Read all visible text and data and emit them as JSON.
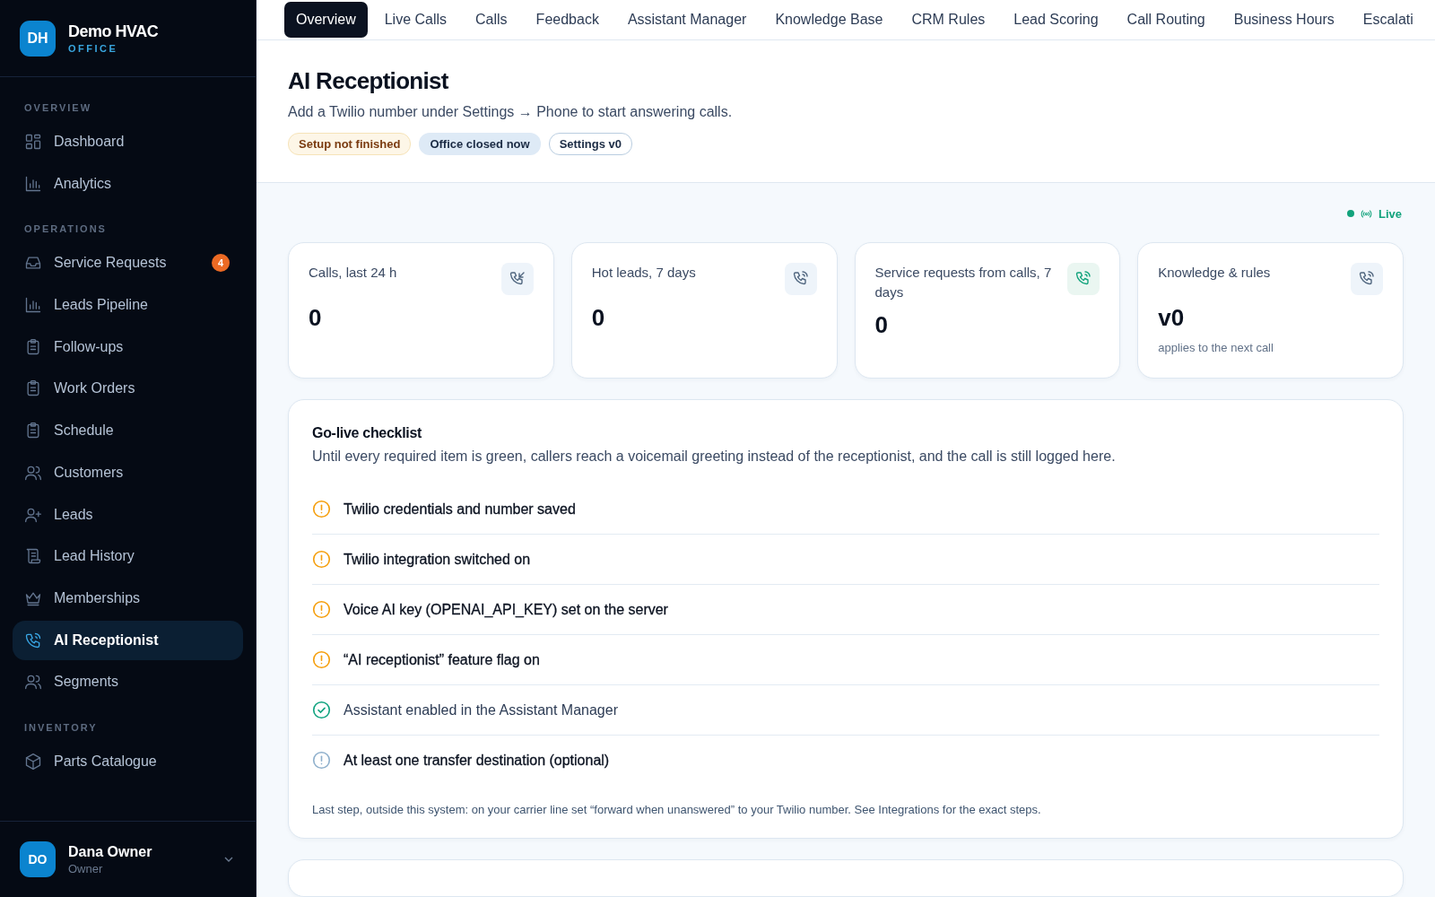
{
  "brand": {
    "initials": "DH",
    "name": "Demo HVAC",
    "subtitle": "OFFICE"
  },
  "sidebar": {
    "sections": [
      {
        "title": "OVERVIEW",
        "items": [
          {
            "label": "Dashboard",
            "selected": false
          },
          {
            "label": "Analytics",
            "selected": false
          }
        ]
      },
      {
        "title": "OPERATIONS",
        "items": [
          {
            "label": "Service Requests",
            "selected": false,
            "badge": "4"
          },
          {
            "label": "Leads Pipeline",
            "selected": false
          },
          {
            "label": "Follow-ups",
            "selected": false
          },
          {
            "label": "Work Orders",
            "selected": false
          },
          {
            "label": "Schedule",
            "selected": false
          },
          {
            "label": "Customers",
            "selected": false
          },
          {
            "label": "Leads",
            "selected": false
          },
          {
            "label": "Lead History",
            "selected": false
          },
          {
            "label": "Memberships",
            "selected": false
          },
          {
            "label": "AI Receptionist",
            "selected": true
          },
          {
            "label": "Segments",
            "selected": false
          }
        ]
      },
      {
        "title": "INVENTORY",
        "items": [
          {
            "label": "Parts Catalogue",
            "selected": false
          }
        ]
      }
    ]
  },
  "user": {
    "initials": "DO",
    "name": "Dana Owner",
    "role": "Owner"
  },
  "tabs": [
    {
      "label": "Overview",
      "selected": true
    },
    {
      "label": "Live Calls",
      "selected": false
    },
    {
      "label": "Calls",
      "selected": false
    },
    {
      "label": "Feedback",
      "selected": false
    },
    {
      "label": "Assistant Manager",
      "selected": false
    },
    {
      "label": "Knowledge Base",
      "selected": false
    },
    {
      "label": "CRM Rules",
      "selected": false
    },
    {
      "label": "Lead Scoring",
      "selected": false
    },
    {
      "label": "Call Routing",
      "selected": false
    },
    {
      "label": "Business Hours",
      "selected": false
    },
    {
      "label": "Escalati",
      "selected": false
    }
  ],
  "header": {
    "title": "AI Receptionist",
    "subtitle": "Add a Twilio number under Settings → Phone to start answering calls.",
    "badges": [
      {
        "label": "Setup not finished",
        "kind": "warning"
      },
      {
        "label": "Office closed now",
        "kind": "info"
      },
      {
        "label": "Settings v0",
        "kind": "outline"
      }
    ]
  },
  "live": {
    "label": "Live"
  },
  "stats": [
    {
      "label": "Calls, last 24 h",
      "value": "0",
      "highlighted": false
    },
    {
      "label": "Hot leads, 7 days",
      "value": "0",
      "highlighted": false
    },
    {
      "label": "Service requests from calls, 7 days",
      "value": "0",
      "highlighted": true
    },
    {
      "label": "Knowledge & rules",
      "value": "v0",
      "note": "applies to the next call",
      "highlighted": false
    }
  ],
  "checklist": {
    "title": "Go-live checklist",
    "description": "Until every required item is green, callers reach a voicemail greeting instead of the receptionist, and the call is still logged here.",
    "items": [
      {
        "label": "Twilio credentials and number saved",
        "kind": "pending"
      },
      {
        "label": "Twilio integration switched on",
        "kind": "pending"
      },
      {
        "label": "Voice AI key (OPENAI_API_KEY) set on the server",
        "kind": "pending"
      },
      {
        "label": "“AI receptionist” feature flag on",
        "kind": "pending"
      },
      {
        "label": "Assistant enabled in the Assistant Manager",
        "kind": "done"
      },
      {
        "label": "At least one transfer destination (optional)",
        "kind": "optional"
      }
    ],
    "footnote": "Last step, outside this system: on your carrier line set “forward when unanswered” to your Twilio number. See Integrations for the exact steps."
  }
}
